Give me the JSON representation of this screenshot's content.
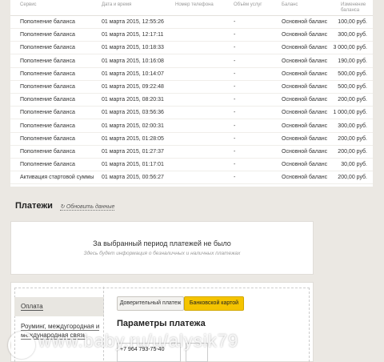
{
  "table": {
    "headers": [
      "Сервис",
      "Дата и время",
      "Номер телефона",
      "Объём услуг",
      "Баланс",
      "Изменение баланса"
    ],
    "rows": [
      {
        "service": "Пополнение баланса",
        "datetime": "01 марта 2015, 12:55:26",
        "phone": "",
        "volume": "-",
        "balance": "Основной баланс",
        "change": "100,00 руб."
      },
      {
        "service": "Пополнение баланса",
        "datetime": "01 марта 2015, 12:17:11",
        "phone": "",
        "volume": "-",
        "balance": "Основной баланс",
        "change": "300,00 руб."
      },
      {
        "service": "Пополнение баланса",
        "datetime": "01 марта 2015, 10:18:33",
        "phone": "",
        "volume": "-",
        "balance": "Основной баланс",
        "change": "3 000,00 руб."
      },
      {
        "service": "Пополнение баланса",
        "datetime": "01 марта 2015, 10:16:08",
        "phone": "",
        "volume": "-",
        "balance": "Основной баланс",
        "change": "190,00 руб."
      },
      {
        "service": "Пополнение баланса",
        "datetime": "01 марта 2015, 10:14:07",
        "phone": "",
        "volume": "-",
        "balance": "Основной баланс",
        "change": "500,00 руб."
      },
      {
        "service": "Пополнение баланса",
        "datetime": "01 марта 2015, 09:22:48",
        "phone": "",
        "volume": "-",
        "balance": "Основной баланс",
        "change": "500,00 руб."
      },
      {
        "service": "Пополнение баланса",
        "datetime": "01 марта 2015, 08:20:31",
        "phone": "",
        "volume": "-",
        "balance": "Основной баланс",
        "change": "200,00 руб."
      },
      {
        "service": "Пополнение баланса",
        "datetime": "01 марта 2015, 03:56:36",
        "phone": "",
        "volume": "-",
        "balance": "Основной баланс",
        "change": "1 000,00 руб."
      },
      {
        "service": "Пополнение баланса",
        "datetime": "01 марта 2015, 02:00:31",
        "phone": "",
        "volume": "-",
        "balance": "Основной баланс",
        "change": "300,00 руб."
      },
      {
        "service": "Пополнение баланса",
        "datetime": "01 марта 2015, 01:28:05",
        "phone": "",
        "volume": "-",
        "balance": "Основной баланс",
        "change": "200,00 руб."
      },
      {
        "service": "Пополнение баланса",
        "datetime": "01 марта 2015, 01:27:37",
        "phone": "",
        "volume": "-",
        "balance": "Основной баланс",
        "change": "200,00 руб."
      },
      {
        "service": "Пополнение баланса",
        "datetime": "01 марта 2015, 01:17:01",
        "phone": "",
        "volume": "-",
        "balance": "Основной баланс",
        "change": "30,00 руб."
      },
      {
        "service": "Активация стартовой суммы",
        "datetime": "01 марта 2015, 00:56:27",
        "phone": "",
        "volume": "-",
        "balance": "Основной баланс",
        "change": "200,00 руб."
      }
    ]
  },
  "payments": {
    "title": "Платежи",
    "refresh_label": "Обновить данные",
    "empty_title": "За выбранный период платежей не было",
    "empty_subtitle": "Здесь будет информация о безналичных и наличных платежах"
  },
  "payment_form": {
    "sidebar_items": [
      "Оплата",
      "Роуминг, междугородная и международная связь"
    ],
    "tabs": [
      "Доверительный платеж",
      "Банковской картой"
    ],
    "active_tab": "Банковской картой",
    "title": "Параметры платежа",
    "phone_value": "+7 964 793-75-40"
  },
  "watermark": {
    "text": "www.baby.ru/u/alysik79"
  },
  "colors": {
    "accent": "#f5c400",
    "background": "#ebe8e3",
    "panel": "#ffffff"
  }
}
